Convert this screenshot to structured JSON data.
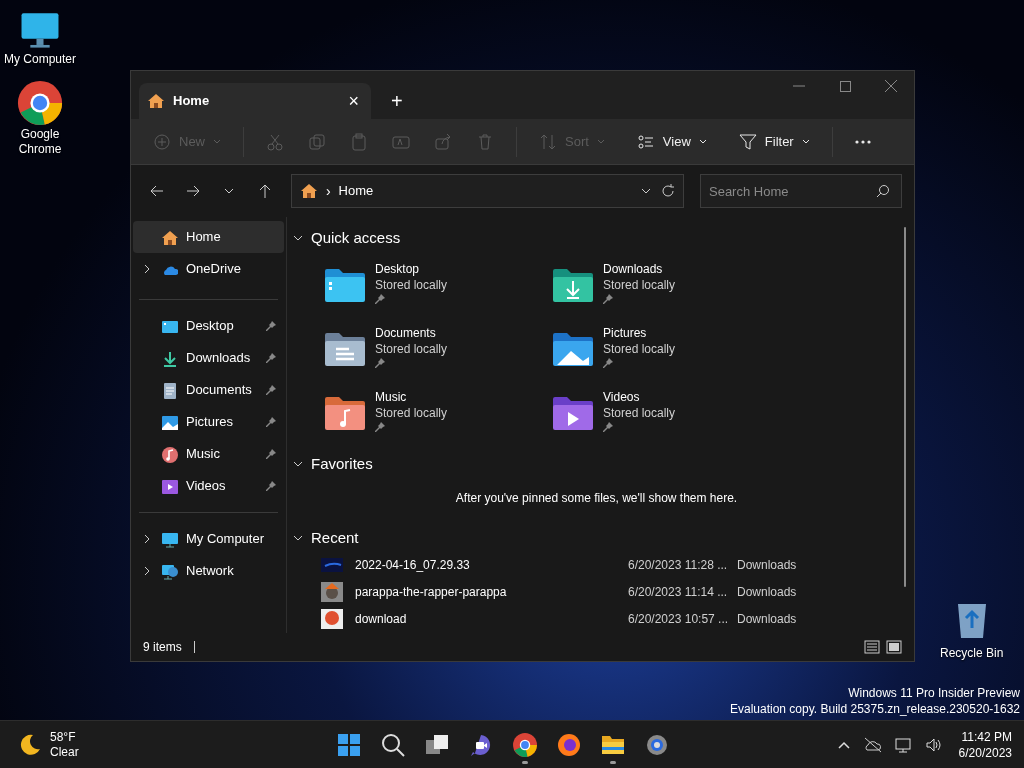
{
  "desktop_icons": [
    {
      "kind": "computer",
      "label": "My Computer"
    },
    {
      "kind": "chrome",
      "label": "Google Chrome"
    }
  ],
  "recycle_bin": {
    "label": "Recycle Bin"
  },
  "watermark": [
    "Windows 11 Pro Insider Preview",
    "Evaluation copy. Build 25375.zn_release.230520-1632"
  ],
  "window": {
    "tab": {
      "title": "Home",
      "close": "×"
    },
    "new_tab": "+"
  },
  "toolbar": [
    {
      "kind": "new",
      "label": "New",
      "disabled": true
    },
    {
      "kind": "cut",
      "disabled": true
    },
    {
      "kind": "copy",
      "disabled": true
    },
    {
      "kind": "paste",
      "disabled": true
    },
    {
      "kind": "rename",
      "disabled": true
    },
    {
      "kind": "share",
      "disabled": true
    },
    {
      "kind": "delete",
      "disabled": true
    },
    {
      "kind": "sort",
      "label": "Sort",
      "disabled": true
    },
    {
      "kind": "view",
      "label": "View",
      "disabled": false
    },
    {
      "kind": "filter",
      "label": "Filter",
      "disabled": false
    },
    {
      "kind": "more",
      "disabled": false
    }
  ],
  "address": {
    "separator": "›",
    "location": "Home"
  },
  "search": {
    "placeholder": "Search Home"
  },
  "sidebar": {
    "groups": [
      [
        {
          "kind": "home",
          "label": "Home",
          "selected": true,
          "expandable": false,
          "pinned": false
        },
        {
          "kind": "onedrive",
          "label": "OneDrive",
          "selected": false,
          "expandable": true,
          "pinned": false
        }
      ],
      [
        {
          "kind": "desktop",
          "label": "Desktop",
          "selected": false,
          "expandable": false,
          "pinned": true
        },
        {
          "kind": "downloads",
          "label": "Downloads",
          "selected": false,
          "expandable": false,
          "pinned": true
        },
        {
          "kind": "documents",
          "label": "Documents",
          "selected": false,
          "expandable": false,
          "pinned": true
        },
        {
          "kind": "pictures",
          "label": "Pictures",
          "selected": false,
          "expandable": false,
          "pinned": true
        },
        {
          "kind": "music",
          "label": "Music",
          "selected": false,
          "expandable": false,
          "pinned": true
        },
        {
          "kind": "videos",
          "label": "Videos",
          "selected": false,
          "expandable": false,
          "pinned": true
        }
      ],
      [
        {
          "kind": "computer",
          "label": "My Computer",
          "selected": false,
          "expandable": true,
          "pinned": false
        },
        {
          "kind": "network",
          "label": "Network",
          "selected": false,
          "expandable": true,
          "pinned": false
        }
      ]
    ]
  },
  "quick_access": {
    "title": "Quick access",
    "expanded": true,
    "items": [
      {
        "kind": "desktop",
        "name": "Desktop",
        "status": "Stored locally"
      },
      {
        "kind": "downloads",
        "name": "Downloads",
        "status": "Stored locally"
      },
      {
        "kind": "documents",
        "name": "Documents",
        "status": "Stored locally"
      },
      {
        "kind": "pictures",
        "name": "Pictures",
        "status": "Stored locally"
      },
      {
        "kind": "music",
        "name": "Music",
        "status": "Stored locally"
      },
      {
        "kind": "videos",
        "name": "Videos",
        "status": "Stored locally"
      }
    ]
  },
  "favorites": {
    "title": "Favorites",
    "expanded": true,
    "message": "After you've pinned some files, we'll show them here."
  },
  "recent": {
    "title": "Recent",
    "expanded": true,
    "rows": [
      {
        "kind": "dark",
        "name": "2022-04-16_07.29.33",
        "modified": "6/20/2023 11:28 ...",
        "location": "Downloads"
      },
      {
        "kind": "photo",
        "name": "parappa-the-rapper-parappa",
        "modified": "6/20/2023 11:14 ...",
        "location": "Downloads"
      },
      {
        "kind": "red",
        "name": "download",
        "modified": "6/20/2023 10:57 ...",
        "location": "Downloads"
      }
    ]
  },
  "status_bar": {
    "count": "9 items"
  },
  "weather": {
    "temp": "58°F",
    "condition": "Clear"
  },
  "taskbar": [
    {
      "kind": "start",
      "running": false
    },
    {
      "kind": "search",
      "running": false
    },
    {
      "kind": "taskview",
      "running": false
    },
    {
      "kind": "meet",
      "running": false
    },
    {
      "kind": "chrome",
      "running": true
    },
    {
      "kind": "firefox",
      "running": false
    },
    {
      "kind": "explorer",
      "running": true
    },
    {
      "kind": "settings",
      "running": false
    }
  ],
  "clock": {
    "time": "11:42 PM",
    "date": "6/20/2023"
  }
}
